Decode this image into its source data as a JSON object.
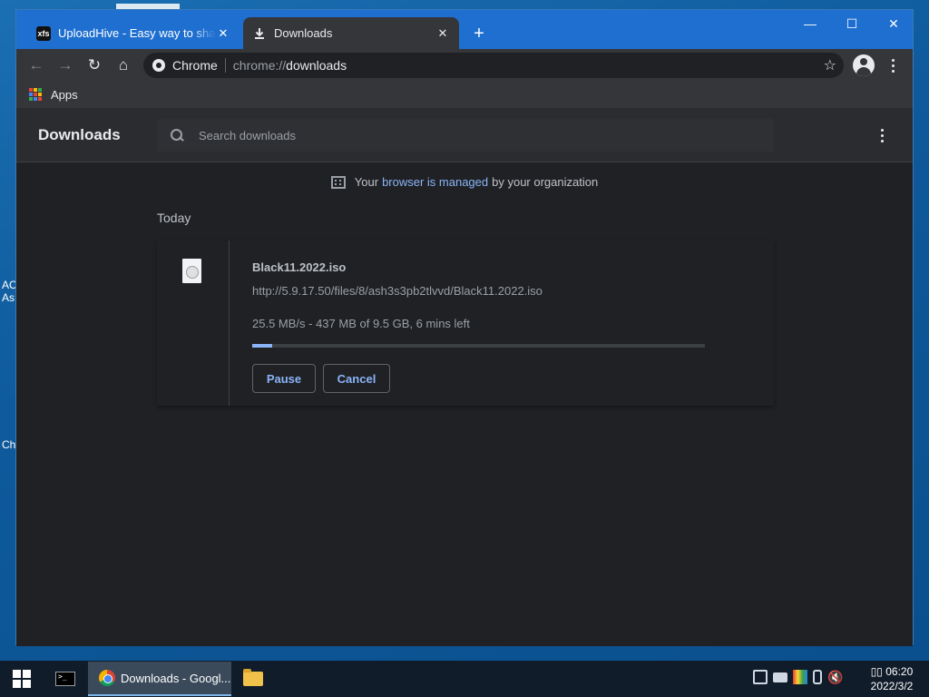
{
  "desktop": {
    "frag_1": "AC",
    "frag_2": "As",
    "frag_3": "Ch"
  },
  "tabs": [
    {
      "title": "UploadHive - Easy way to share your files",
      "favicon_text": "xfs",
      "close": "✕"
    },
    {
      "title": "Downloads",
      "close": "✕"
    }
  ],
  "new_tab": "+",
  "window_controls": {
    "minimize": "—",
    "maximize": "☐",
    "close": "✕"
  },
  "toolbar": {
    "back": "←",
    "forward": "→",
    "reload": "↻",
    "home": "⌂",
    "omnibox_chip": "Chrome",
    "url_scheme": "chrome://",
    "url_host": "downloads",
    "bookmark_star": "☆"
  },
  "bookmarks": {
    "apps": "Apps"
  },
  "downloads_page": {
    "title": "Downloads",
    "search_placeholder": "Search downloads",
    "managed_prefix": "Your",
    "managed_link": "browser is managed",
    "managed_suffix": "by your organization",
    "section_label": "Today",
    "item": {
      "file_name": "Black11.2022.iso",
      "url": "http://5.9.17.50/files/8/ash3s3pb2tlvvd/Black11.2022.iso",
      "status": "25.5 MB/s - 437 MB of 9.5 GB, 6 mins left",
      "progress_fraction": 0.045,
      "pause_label": "Pause",
      "cancel_label": "Cancel"
    }
  },
  "taskbar": {
    "chrome_task_label": "Downloads - Googl...",
    "clock_time": "▯▯ 06:20",
    "clock_date": "2022/3/2"
  },
  "colors": {
    "tabstrip": "#1e6fd0",
    "page_bg": "#202124",
    "link": "#8ab4f8",
    "progress_fill": "#8ab4f8"
  }
}
